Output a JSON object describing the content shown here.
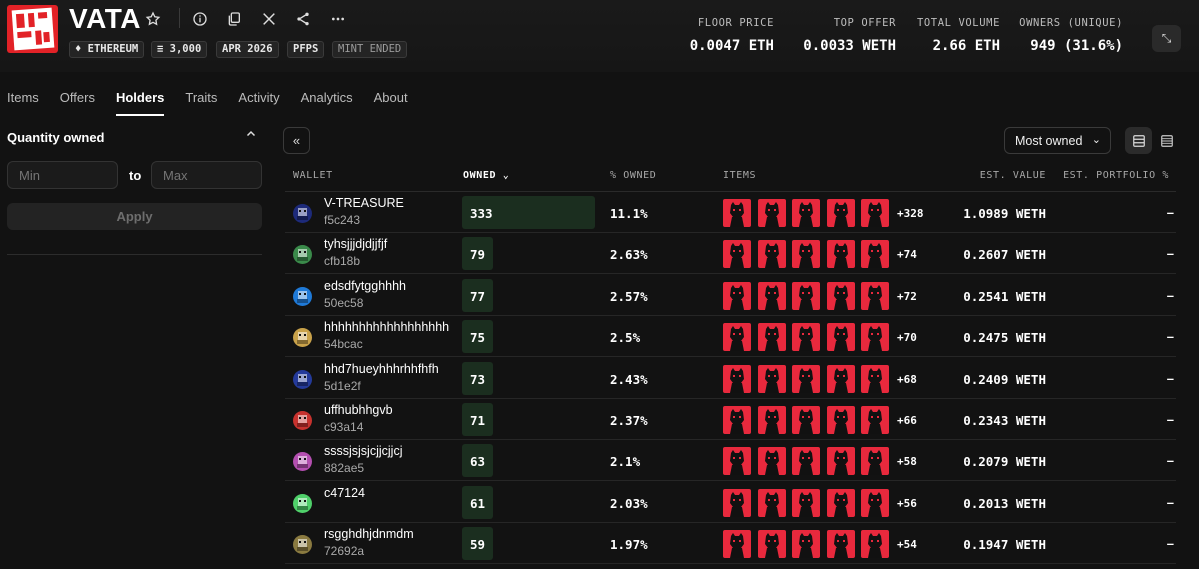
{
  "collection": {
    "name": "VATA",
    "chain": "ETHEREUM",
    "supply": "3,000",
    "date": "APR 2026",
    "category": "PFPS",
    "status": "MINT ENDED"
  },
  "stats": [
    {
      "label": "FLOOR PRICE",
      "value": "0.0047 ETH"
    },
    {
      "label": "TOP OFFER",
      "value": "0.0033 WETH"
    },
    {
      "label": "TOTAL VOLUME",
      "value": "2.66 ETH"
    },
    {
      "label": "OWNERS (UNIQUE)",
      "value": "949 (31.6%)"
    }
  ],
  "tabs": [
    "Items",
    "Offers",
    "Holders",
    "Traits",
    "Activity",
    "Analytics",
    "About"
  ],
  "active_tab": "Holders",
  "filter": {
    "title": "Quantity owned",
    "min_placeholder": "Min",
    "to_label": "to",
    "max_placeholder": "Max",
    "apply_label": "Apply"
  },
  "sort": {
    "selected": "Most owned"
  },
  "columns": {
    "wallet": "WALLET",
    "owned": "OWNED",
    "pct_owned": "% OWNED",
    "items": "ITEMS",
    "est_value": "EST. VALUE",
    "est_portfolio": "EST. PORTFOLIO %"
  },
  "holders": [
    {
      "name": "V-TREASURE",
      "addr": "f5c243",
      "owned": 333,
      "owned_str": "333",
      "pct": "11.1%",
      "more": "+328",
      "value": "1.0989 WETH",
      "portfolio": "–",
      "avatar_color": "#1d2a7a"
    },
    {
      "name": "tyhsjjjdjdjjfjf",
      "addr": "cfb18b",
      "owned": 79,
      "owned_str": "79",
      "pct": "2.63%",
      "more": "+74",
      "value": "0.2607 WETH",
      "portfolio": "–",
      "avatar_color": "#3a8a4a"
    },
    {
      "name": "edsdfytgghhhh",
      "addr": "50ec58",
      "owned": 77,
      "owned_str": "77",
      "pct": "2.57%",
      "more": "+72",
      "value": "0.2541 WETH",
      "portfolio": "–",
      "avatar_color": "#1f7ad8"
    },
    {
      "name": "hhhhhhhhhhhhhhhhhhhhoo",
      "addr": "54bcac",
      "owned": 75,
      "owned_str": "75",
      "pct": "2.5%",
      "more": "+70",
      "value": "0.2475 WETH",
      "portfolio": "–",
      "avatar_color": "#c9a24a"
    },
    {
      "name": "hhd7hueyhhhrhhfhfh",
      "addr": "5d1e2f",
      "owned": 73,
      "owned_str": "73",
      "pct": "2.43%",
      "more": "+68",
      "value": "0.2409 WETH",
      "portfolio": "–",
      "avatar_color": "#243a9a"
    },
    {
      "name": "uffhubhhgvb",
      "addr": "c93a14",
      "owned": 71,
      "owned_str": "71",
      "pct": "2.37%",
      "more": "+66",
      "value": "0.2343 WETH",
      "portfolio": "–",
      "avatar_color": "#c8322e"
    },
    {
      "name": "ssssjsjsjcjjcjjcj",
      "addr": "882ae5",
      "owned": 63,
      "owned_str": "63",
      "pct": "2.1%",
      "more": "+58",
      "value": "0.2079 WETH",
      "portfolio": "–",
      "avatar_color": "#b44fb0"
    },
    {
      "name": "c47124",
      "addr": "",
      "owned": 61,
      "owned_str": "61",
      "pct": "2.03%",
      "more": "+56",
      "value": "0.2013 WETH",
      "portfolio": "–",
      "avatar_color": "#4fd06a"
    },
    {
      "name": "rsgghdhjdnmdm",
      "addr": "72692a",
      "owned": 59,
      "owned_str": "59",
      "pct": "1.97%",
      "more": "+54",
      "value": "0.1947 WETH",
      "portfolio": "–",
      "avatar_color": "#8a7a40"
    }
  ],
  "colors": {
    "accent_red": "#e22227",
    "owned_bar": "#1b2e1f",
    "nft_bg": "#e8293d"
  }
}
